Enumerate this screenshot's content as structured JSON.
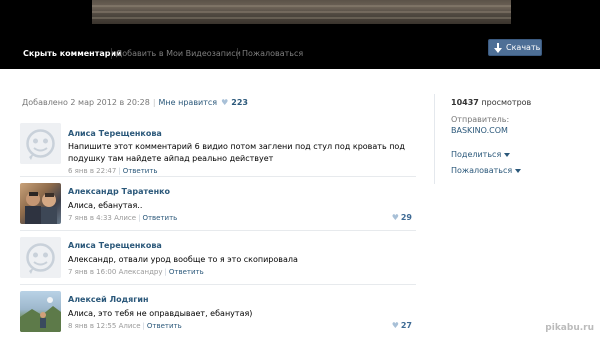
{
  "player_toolbar": {
    "hide_comments": "Скрыть комментарии",
    "add_to_videos": "Добавить в Мои Видеозаписи",
    "report": "Пожаловаться",
    "download": "Скачать"
  },
  "meta": {
    "added": "Добавлено 2 мар 2012 в 20:28",
    "like_link": "Мне нравится",
    "like_count": "223"
  },
  "right_col": {
    "views_count": "10437",
    "views_label": " просмотров",
    "sender_label": "Отправитель:",
    "sender_value": "BASKINO.COM",
    "share": "Поделиться",
    "report": "Пожаловаться"
  },
  "comments": [
    {
      "author": "Алиса Терещенкова",
      "text": "Напишите этот комментарий 6 видио потом заглени под стул под кровать под подушку там найдете айпад реально действует",
      "time": "6 янв в 22:47",
      "reply": "Ответить",
      "likes": ""
    },
    {
      "author": "Александр Таратенко",
      "text": "Алиса, ебанутая..",
      "time": "7 янв в 4:33 Алисе",
      "reply": "Ответить",
      "likes": "29"
    },
    {
      "author": "Алиса Терещенкова",
      "text": "Александр, отвали урод вообще то я это скопировала",
      "time": "7 янв в 16:00 Александру",
      "reply": "Ответить",
      "likes": ""
    },
    {
      "author": "Алексей Лодягин",
      "text": "Алиса, это тебя не оправдывает, ебанутая)",
      "time": "8 янв в 12:55 Алисе",
      "reply": "Ответить",
      "likes": "27"
    }
  ],
  "watermark": "pikabu.ru"
}
